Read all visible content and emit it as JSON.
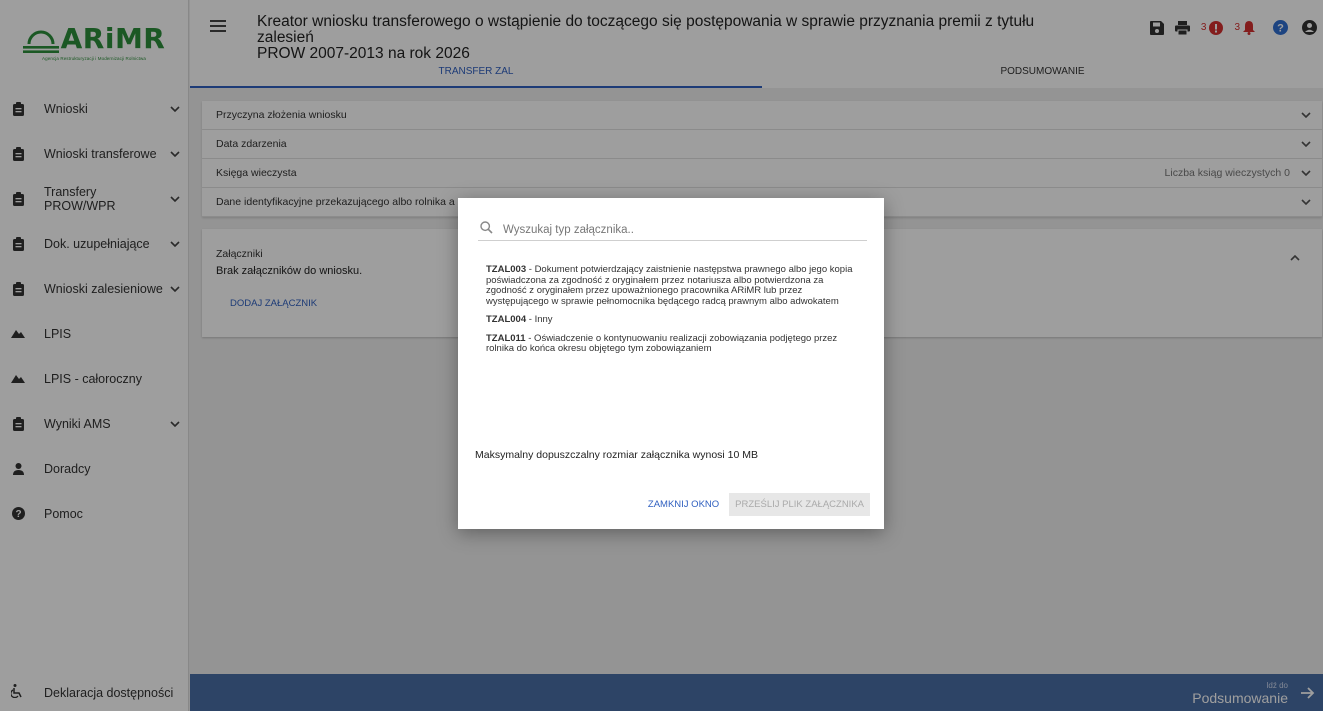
{
  "logo": {
    "text": "ARiMR",
    "subtitle": "Agencja Restrukturyzacji i Modernizacji Rolnictwa"
  },
  "sidebar": {
    "items": [
      {
        "label": "Wnioski",
        "icon": "clipboard-icon",
        "has_chevron": true
      },
      {
        "label": "Wnioski transferowe",
        "icon": "clipboard-icon",
        "has_chevron": true
      },
      {
        "label": "Transfery PROW/WPR",
        "icon": "clipboard-icon",
        "has_chevron": true
      },
      {
        "label": "Dok. uzupełniające",
        "icon": "clipboard-icon",
        "has_chevron": true
      },
      {
        "label": "Wnioski zalesieniowe",
        "icon": "clipboard-icon",
        "has_chevron": true
      },
      {
        "label": "LPIS",
        "icon": "mountain-icon",
        "has_chevron": false
      },
      {
        "label": "LPIS - całoroczny",
        "icon": "mountain-icon",
        "has_chevron": false
      },
      {
        "label": "Wyniki AMS",
        "icon": "clipboard-icon",
        "has_chevron": true
      },
      {
        "label": "Doradcy",
        "icon": "user-icon",
        "has_chevron": false
      },
      {
        "label": "Pomoc",
        "icon": "help-circle-icon",
        "has_chevron": false
      }
    ],
    "accessibility_label": "Deklaracja dostępności"
  },
  "header": {
    "title_line1": "Kreator wniosku transferowego o wstąpienie do toczącego się postępowania w sprawie przyznania premii z tytułu zalesień",
    "title_line2": "PROW 2007-2013 na rok 2026",
    "warning_count": "3",
    "notification_count": "3"
  },
  "tabs": [
    {
      "label": "TRANSFER ZAL",
      "active": true
    },
    {
      "label": "PODSUMOWANIE",
      "active": false
    }
  ],
  "panels": [
    {
      "label": "Przyczyna złożenia wniosku",
      "meta": ""
    },
    {
      "label": "Data zdarzenia",
      "meta": ""
    },
    {
      "label": "Księga wieczysta",
      "meta": "Liczba ksiąg wieczystych 0"
    },
    {
      "label": "Dane identyfikacyjne przekazującego albo rolnika a",
      "meta": ""
    }
  ],
  "attachments": {
    "title": "Załączniki",
    "empty_text": "Brak załączników do wniosku.",
    "add_label": "DODAJ ZAŁĄCZNIK"
  },
  "modal": {
    "search_placeholder": "Wyszukaj typ załącznika..",
    "options": [
      {
        "code": "TZAL003",
        "description": " - Dokument potwierdzający zaistnienie następstwa prawnego albo jego kopia poświadczona za zgodność z oryginałem przez notariusza albo potwierdzona za zgodność z oryginałem przez upoważnionego pracownika ARiMR lub przez występującego w sprawie pełnomocnika będącego radcą prawnym albo adwokatem"
      },
      {
        "code": "TZAL004",
        "description": " - Inny"
      },
      {
        "code": "TZAL011",
        "description": " - Oświadczenie o kontynuowaniu realizacji zobowiązania podjętego przez rolnika do końca okresu objętego tym zobowiązaniem"
      }
    ],
    "max_size_text": "Maksymalny dopuszczalny rozmiar załącznika wynosi 10 MB",
    "close_label": "ZAMKNIJ OKNO",
    "upload_label": "PRZEŚLIJ PLIK ZAŁĄCZNIKA"
  },
  "footer": {
    "small_label": "Idź do",
    "big_label": "Podsumowanie"
  },
  "colors": {
    "brand_green": "#2c8f3a",
    "accent_blue": "#3060c0",
    "footer_blue": "#4a6fa5",
    "alert_red": "#d32f2f",
    "help_blue": "#2f6fd0"
  }
}
